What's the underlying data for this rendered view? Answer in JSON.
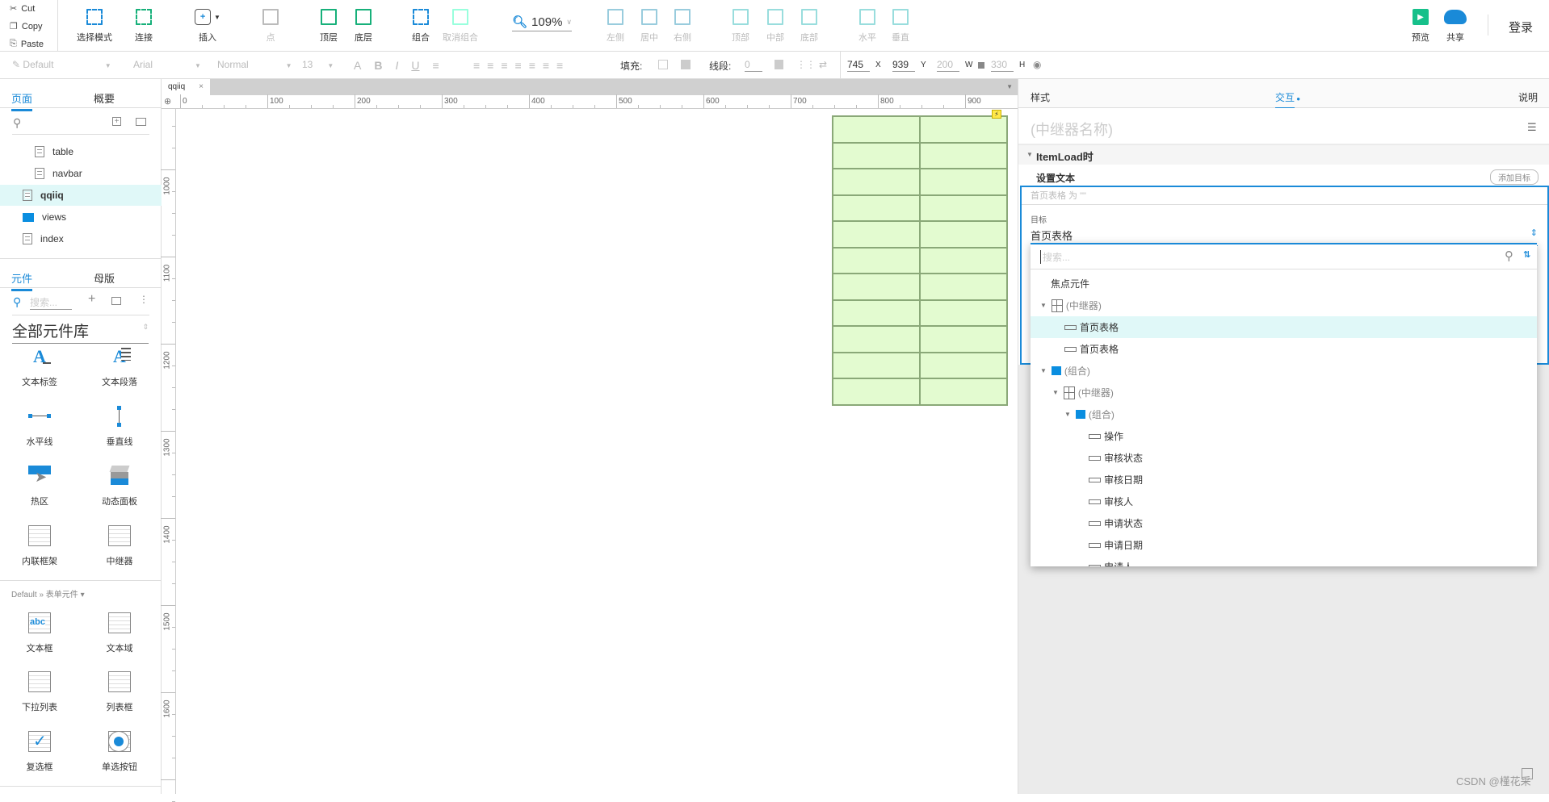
{
  "clipboard": [
    {
      "label": "Cut",
      "icon": "scissors-icon"
    },
    {
      "label": "Copy",
      "icon": "copy-icon"
    },
    {
      "label": "Paste",
      "icon": "paste-icon"
    }
  ],
  "toolbar": [
    {
      "label": "选择模式",
      "icon": "select-mode-icon",
      "enabled": true
    },
    {
      "label": "连接",
      "icon": "connect-icon",
      "enabled": true
    },
    {
      "label": "插入",
      "icon": "insert-icon",
      "enabled": true
    },
    {
      "label": "点",
      "icon": "point-icon",
      "enabled": false
    },
    {
      "label": "顶层",
      "icon": "bring-front-icon",
      "enabled": true
    },
    {
      "label": "底层",
      "icon": "send-back-icon",
      "enabled": true
    },
    {
      "label": "组合",
      "icon": "group-icon",
      "enabled": true
    },
    {
      "label": "取消组合",
      "icon": "ungroup-icon",
      "enabled": false
    },
    {
      "label": "左侧",
      "icon": "align-left-icon",
      "enabled": false
    },
    {
      "label": "居中",
      "icon": "align-center-icon",
      "enabled": false
    },
    {
      "label": "右侧",
      "icon": "align-right-icon",
      "enabled": false
    },
    {
      "label": "顶部",
      "icon": "align-top-icon",
      "enabled": false
    },
    {
      "label": "中部",
      "icon": "align-middle-icon",
      "enabled": false
    },
    {
      "label": "底部",
      "icon": "align-bottom-icon",
      "enabled": false
    },
    {
      "label": "水平",
      "icon": "distribute-horizontal-icon",
      "enabled": false
    },
    {
      "label": "垂直",
      "icon": "distribute-vertical-icon",
      "enabled": false
    }
  ],
  "zoom": "109%",
  "preview_label": "预览",
  "share_label": "共享",
  "login_label": "登录",
  "format": {
    "style": "Default",
    "font": "Arial",
    "weight": "Normal",
    "size": "13",
    "fill_label": "填充:",
    "line_label": "线段:",
    "line_value": "0",
    "x": "745",
    "x_label": "X",
    "y": "939",
    "y_label": "Y",
    "w": "200",
    "w_label": "W",
    "h": "330",
    "h_label": "H"
  },
  "left": {
    "pages_tab": "页面",
    "outline_tab": "概要",
    "pages": [
      {
        "label": "table",
        "type": "page",
        "level": 2
      },
      {
        "label": "navbar",
        "type": "page",
        "level": 2
      },
      {
        "label": "qqiiq",
        "type": "page",
        "level": 1,
        "selected": true
      },
      {
        "label": "views",
        "type": "folder",
        "level": 1
      },
      {
        "label": "index",
        "type": "page",
        "level": 1
      }
    ],
    "widgets_tab": "元件",
    "masters_tab": "母版",
    "search_placeholder": "搜索...",
    "library": "全部元件库",
    "widgets": [
      {
        "label": "文本标签",
        "icon": "text-label-icon"
      },
      {
        "label": "文本段落",
        "icon": "text-paragraph-icon"
      },
      {
        "label": "水平线",
        "icon": "horizontal-line-icon"
      },
      {
        "label": "垂直线",
        "icon": "vertical-line-icon"
      },
      {
        "label": "热区",
        "icon": "hotspot-icon"
      },
      {
        "label": "动态面板",
        "icon": "dynamic-panel-icon"
      },
      {
        "label": "内联框架",
        "icon": "inline-frame-icon"
      },
      {
        "label": "中继器",
        "icon": "repeater-icon"
      }
    ],
    "form_section": "Default » 表单元件 ▾",
    "form_widgets": [
      {
        "label": "文本框",
        "icon": "text-field-icon"
      },
      {
        "label": "文本域",
        "icon": "text-area-icon"
      },
      {
        "label": "下拉列表",
        "icon": "droplist-icon"
      },
      {
        "label": "列表框",
        "icon": "listbox-icon"
      },
      {
        "label": "复选框",
        "icon": "checkbox-icon"
      },
      {
        "label": "单选按钮",
        "icon": "radio-button-icon"
      }
    ]
  },
  "doc_tab": "qqiiq",
  "ruler": {
    "h": [
      "0",
      "100",
      "200",
      "300",
      "400",
      "500",
      "600",
      "700",
      "800",
      "900"
    ],
    "v": [
      "1000",
      "1100",
      "1200",
      "1300",
      "1400",
      "1500",
      "1600"
    ]
  },
  "right": {
    "tabs": [
      "样式",
      "交互",
      "说明"
    ],
    "active_tab": "交互",
    "name_placeholder": "(中继器名称)",
    "event": "ItemLoad时",
    "action": "设置文本",
    "add_target": "添加目标",
    "summary": "首页表格 为 \"\"",
    "target_label": "目标",
    "target_value": "首页表格",
    "dd_search_placeholder": "搜索...",
    "tree": [
      {
        "label": "焦点元件",
        "type": "none",
        "level": 0
      },
      {
        "label": "(中继器)",
        "type": "repeater",
        "level": 0,
        "expand": true
      },
      {
        "label": "首页表格",
        "type": "rect",
        "level": 1,
        "selected": true
      },
      {
        "label": "首页表格",
        "type": "rect",
        "level": 1
      },
      {
        "label": "(组合)",
        "type": "group",
        "level": 0,
        "expand": true
      },
      {
        "label": "(中继器)",
        "type": "repeater",
        "level": 1,
        "expand": true
      },
      {
        "label": "(组合)",
        "type": "group",
        "level": 2,
        "expand": true
      },
      {
        "label": "操作",
        "type": "rect",
        "level": 3
      },
      {
        "label": "审核状态",
        "type": "rect",
        "level": 3
      },
      {
        "label": "审核日期",
        "type": "rect",
        "level": 3
      },
      {
        "label": "审核人",
        "type": "rect",
        "level": 3
      },
      {
        "label": "申请状态",
        "type": "rect",
        "level": 3
      },
      {
        "label": "申请日期",
        "type": "rect",
        "level": 3
      },
      {
        "label": "申请人",
        "type": "rect",
        "level": 3
      }
    ]
  },
  "watermark": "CSDN @槿花采",
  "colors": {
    "accent": "#1a8ad8",
    "repeater_fill": "#e3fbd0",
    "selected_row": "#e0f8f8"
  }
}
